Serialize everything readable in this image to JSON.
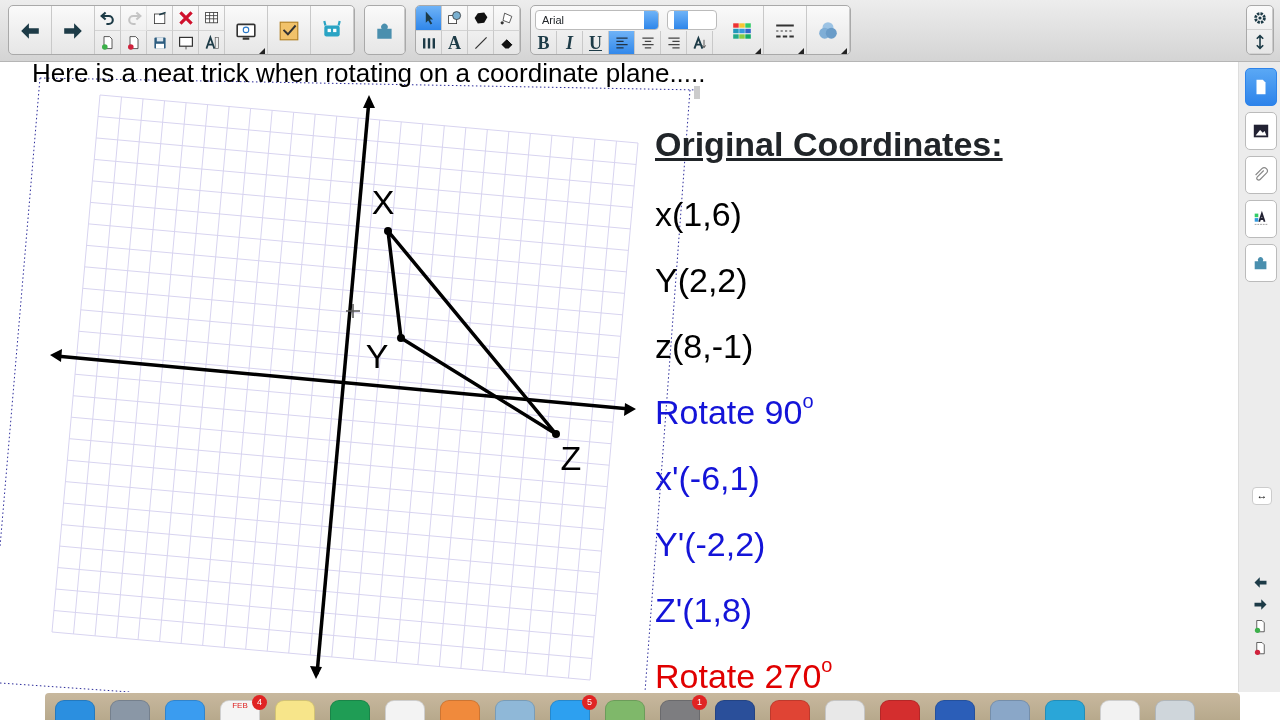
{
  "toolbar": {
    "nav_buttons": [
      {
        "kind": "back"
      },
      {
        "kind": "forward"
      }
    ],
    "small_buttons": [
      {
        "kind": "undo"
      },
      {
        "kind": "redo",
        "disabled": true
      },
      {
        "kind": "export"
      },
      {
        "kind": "delete"
      },
      {
        "kind": "table"
      },
      {
        "kind": "page-add"
      },
      {
        "kind": "page-delete"
      },
      {
        "kind": "save"
      },
      {
        "kind": "screen"
      },
      {
        "kind": "measure"
      }
    ],
    "big_buttons": [
      {
        "kind": "capture"
      },
      {
        "kind": "check"
      },
      {
        "kind": "robot"
      }
    ],
    "addon_buttons": [
      {
        "kind": "puzzle"
      }
    ],
    "drawing_tools": [
      {
        "kind": "select",
        "selected": true
      },
      {
        "kind": "shape",
        "selected": false
      },
      {
        "kind": "polygon",
        "selected": false
      },
      {
        "kind": "bucket",
        "selected": false
      },
      {
        "kind": "pens",
        "selected": false
      },
      {
        "kind": "text",
        "label": "A",
        "selected": false
      },
      {
        "kind": "line",
        "selected": false
      },
      {
        "kind": "eraser",
        "selected": false
      }
    ],
    "font_name": "Arial",
    "format_buttons": [
      {
        "kind": "bold",
        "label": "B",
        "selected": false
      },
      {
        "kind": "italic",
        "label": "I",
        "selected": false
      },
      {
        "kind": "underline",
        "label": "U",
        "selected": false
      },
      {
        "kind": "align-left",
        "selected": true
      },
      {
        "kind": "align-center",
        "selected": false
      },
      {
        "kind": "align-right",
        "selected": false
      },
      {
        "kind": "text-size",
        "selected": false
      }
    ],
    "style_buttons": [
      {
        "kind": "colors"
      },
      {
        "kind": "line-style"
      },
      {
        "kind": "fill"
      }
    ],
    "corner_buttons": [
      {
        "kind": "gear"
      },
      {
        "kind": "updown"
      }
    ]
  },
  "page": {
    "title": "Here is a neat trick when rotating on a coordinate plane.....",
    "graph_labels": [
      {
        "text": "X"
      },
      {
        "text": "Y"
      },
      {
        "text": "Z"
      }
    ],
    "heading": "Original Coordinates:",
    "lines": [
      {
        "text": "x(1,6)",
        "color": "#000000"
      },
      {
        "text": "Y(2,2)",
        "color": "#000000"
      },
      {
        "text": "z(8,-1)",
        "color": "#000000"
      },
      {
        "text": "Rotate 90$^{o}$",
        "color": "#1414d8"
      },
      {
        "text": "x'(-6,1)",
        "color": "#1414d8"
      },
      {
        "text": "Y'(-2,2)",
        "color": "#1414d8"
      },
      {
        "text": "Z'(1,8)",
        "color": "#1414d8"
      },
      {
        "text": "Rotate 270$^{o}$",
        "color": "#e00000"
      }
    ]
  },
  "sidebar": {
    "tabs": [
      {
        "kind": "page",
        "selected": true
      },
      {
        "kind": "image",
        "selected": false
      },
      {
        "kind": "clip",
        "selected": false
      },
      {
        "kind": "textstyle",
        "selected": false
      },
      {
        "kind": "puzzle",
        "selected": false
      }
    ],
    "resize_glyph": "↔",
    "bottom_buttons": [
      {
        "kind": "back"
      },
      {
        "kind": "forward"
      },
      {
        "kind": "page-add"
      },
      {
        "kind": "page-delete"
      }
    ]
  },
  "dock": {
    "apps": [
      {
        "color": "#2b8fe0"
      },
      {
        "color": "#8a97a6"
      },
      {
        "color": "#3a9cf0"
      },
      {
        "color": "#f4f4f4",
        "label": "FEB",
        "badge": "4"
      },
      {
        "color": "#f7e58a"
      },
      {
        "color": "#1f9d55"
      },
      {
        "color": "#f3f3f3"
      },
      {
        "color": "#f08a3c"
      },
      {
        "color": "#8fb8d8"
      },
      {
        "color": "#2da0f0",
        "badge": "5"
      },
      {
        "color": "#7fb86a"
      },
      {
        "color": "#7d7d80",
        "badge": "1"
      },
      {
        "color": "#2a4f9a"
      },
      {
        "color": "#e04434"
      },
      {
        "color": "#e8e8e8"
      },
      {
        "color": "#d42e2e"
      },
      {
        "color": "#2b5eb8"
      },
      {
        "color": "#8aa7c8"
      },
      {
        "color": "#2aa6d8"
      },
      {
        "color": "#f2f2f2"
      },
      {
        "color": "#cfd6db"
      }
    ]
  }
}
